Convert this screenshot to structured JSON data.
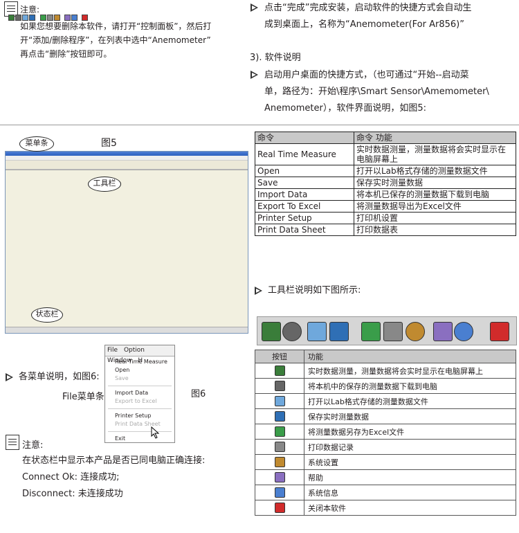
{
  "top_left": {
    "note_label": "注意:",
    "lines": [
      "如果您想要删除本软件，请打开“控制面板”，然后打",
      "开“添加/删除程序”，在列表中选中“Anemometer”",
      "再点击“删除”按钮即可。"
    ]
  },
  "top_right": {
    "bullet1": [
      "点击“完成”完成安装，启动软件的快捷方式会自动生",
      "成到桌面上，名称为“Anemometer(For Ar856)”"
    ],
    "section": "3). 软件说明",
    "bullet2": [
      "启动用户桌面的快捷方式，（也可通过“开始--启动菜",
      "单，路径为：开始\\程序\\Smart Sensor\\Amemometer\\",
      "Anemometer），软件界面说明，如图5:"
    ]
  },
  "figure5": {
    "label": "图5",
    "menubar_callout": "菜单条",
    "toolbar_callout": "工具栏",
    "statusbar_callout": "状态栏"
  },
  "menus_intro": "各菜单说明，如图6:",
  "file_menu_caption": "File菜单条:",
  "figure6": "图6",
  "file_menu": {
    "bar": [
      "File",
      "Option",
      "Window",
      "H"
    ],
    "items": [
      {
        "label": "Real Time Measure",
        "disabled": false
      },
      {
        "label": "Open",
        "disabled": false
      },
      {
        "label": "Save",
        "disabled": true
      },
      {
        "label": "Import Data",
        "disabled": false
      },
      {
        "label": "Export to Excel",
        "disabled": true
      },
      {
        "label": "Printer Setup",
        "disabled": false
      },
      {
        "label": "Print Data Sheet",
        "disabled": true
      },
      {
        "label": "Exit",
        "disabled": false
      }
    ]
  },
  "bottom_note": {
    "label": "注意:",
    "lines": [
      "在状态栏中显示本产品是否已同电脑正确连接:",
      "Connect Ok:  连接成功;",
      "Disconnect:  未连接成功"
    ]
  },
  "command_table": {
    "headers": [
      "命令",
      "命令 功能"
    ],
    "rows": [
      [
        "Real Time Measure",
        "实时数据测量，测量数据将会实时显示在电脑屏幕上"
      ],
      [
        "Open",
        "打开以Lab格式存储的测量数据文件"
      ],
      [
        "Save",
        "保存实时测量数据"
      ],
      [
        "Import Data",
        "将本机已保存的测量数据下载到电脑"
      ],
      [
        "Export To Excel",
        "将测量数据导出为Excel文件"
      ],
      [
        "Printer Setup",
        "打印机设置"
      ],
      [
        "Print Data Sheet",
        "打印数据表"
      ]
    ]
  },
  "toolbar_intro": "工具栏说明如下图所示:",
  "toolbar_icons": [
    {
      "name": "monitor-icon",
      "color": "#3a7d3a"
    },
    {
      "name": "film-reel-icon",
      "color": "#666666"
    },
    {
      "name": "open-folder-icon",
      "color": "#6fa8dc"
    },
    {
      "name": "save-disk-icon",
      "color": "#2f6fb5"
    },
    {
      "name": "excel-export-icon",
      "color": "#3a9d4a"
    },
    {
      "name": "printer-icon",
      "color": "#888888"
    },
    {
      "name": "gear-icon",
      "color": "#c08a30"
    },
    {
      "name": "help-icon",
      "color": "#8a6fc0"
    },
    {
      "name": "info-icon",
      "color": "#4a7fd0"
    },
    {
      "name": "power-icon",
      "color": "#d12b2b"
    }
  ],
  "button_table": {
    "headers": [
      "按钮",
      "功能"
    ],
    "rows": [
      "实时数据测量，测量数据将会实时显示在电脑屏幕上",
      "将本机中的保存的测量数据下载到电脑",
      "打开以Lab格式存储的测量数据文件",
      "保存实时测量数据",
      "将测量数据另存为Excel文件",
      "打印数据记录",
      "系统设置",
      "帮助",
      "系统信息",
      "关闭本软件"
    ]
  }
}
